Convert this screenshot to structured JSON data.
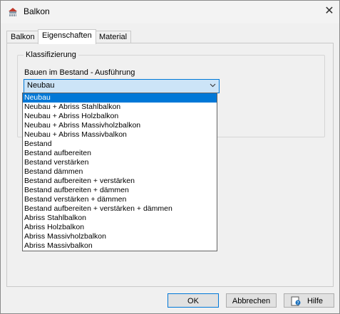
{
  "window": {
    "title": "Balkon"
  },
  "tabs": [
    {
      "label": "Balkon"
    },
    {
      "label": "Eigenschaften"
    },
    {
      "label": "Material"
    }
  ],
  "group": {
    "title": "Klassifizierung"
  },
  "field": {
    "label": "Bauen im Bestand - Ausführung",
    "value": "Neubau"
  },
  "dropdown": {
    "selected_index": 0,
    "options": [
      "Neubau",
      "Neubau + Abriss Stahlbalkon",
      "Neubau + Abriss Holzbalkon",
      "Neubau + Abriss Massivholzbalkon",
      "Neubau + Abriss Massivbalkon",
      "Bestand",
      "Bestand aufbereiten",
      "Bestand verstärken",
      "Bestand dämmen",
      "Bestand aufbereiten + verstärken",
      "Bestand aufbereiten + dämmen",
      "Bestand verstärken + dämmen",
      "Bestand aufbereiten + verstärken + dämmen",
      "Abriss Stahlbalkon",
      "Abriss Holzbalkon",
      "Abriss Massivholzbalkon",
      "Abriss Massivbalkon"
    ]
  },
  "buttons": {
    "ok": "OK",
    "cancel": "Abbrechen",
    "help": "Hilfe"
  },
  "colors": {
    "accent": "#0078d7",
    "combo_bg": "#cce4f7"
  },
  "icons": {
    "app": "balcony-icon",
    "close": "close-icon",
    "combo_arrow": "chevron-down-icon",
    "help": "help-icon"
  }
}
